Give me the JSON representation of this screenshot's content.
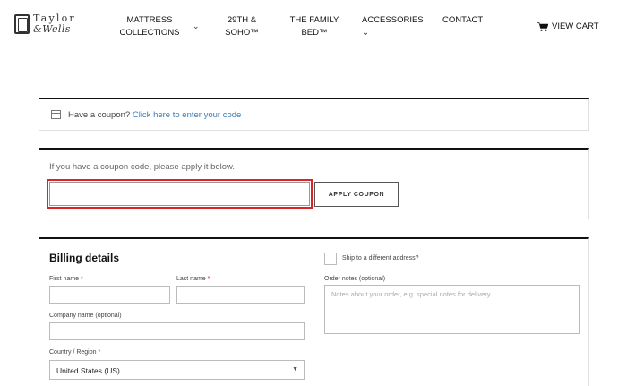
{
  "logo": {
    "line1": "Taylor",
    "line2": "&Wells"
  },
  "nav": {
    "mattress": "MATTRESS COLLECTIONS",
    "twenty_nine": "29TH & SOHO™",
    "family_bed": "THE FAMILY BED™",
    "accessories": "ACCESSORIES",
    "contact": "CONTACT",
    "view_cart": "VIEW CART"
  },
  "coupon_notice": {
    "text": "Have a coupon?",
    "link": "Click here to enter your code"
  },
  "coupon_form": {
    "hint": "If you have a coupon code, please apply it below.",
    "input_value": "",
    "button": "APPLY COUPON"
  },
  "billing": {
    "title": "Billing details",
    "first_name_label": "First name",
    "last_name_label": "Last name",
    "company_label": "Company name (optional)",
    "country_label": "Country / Region",
    "country_value": "United States (US)",
    "required_mark": "*"
  },
  "shipping": {
    "ship_label": "Ship to a different address?",
    "notes_label": "Order notes (optional)",
    "notes_placeholder": "Notes about your order, e.g. special notes for delivery."
  },
  "colors": {
    "accent_link": "#3b7ab5",
    "highlight": "#d9252a"
  }
}
